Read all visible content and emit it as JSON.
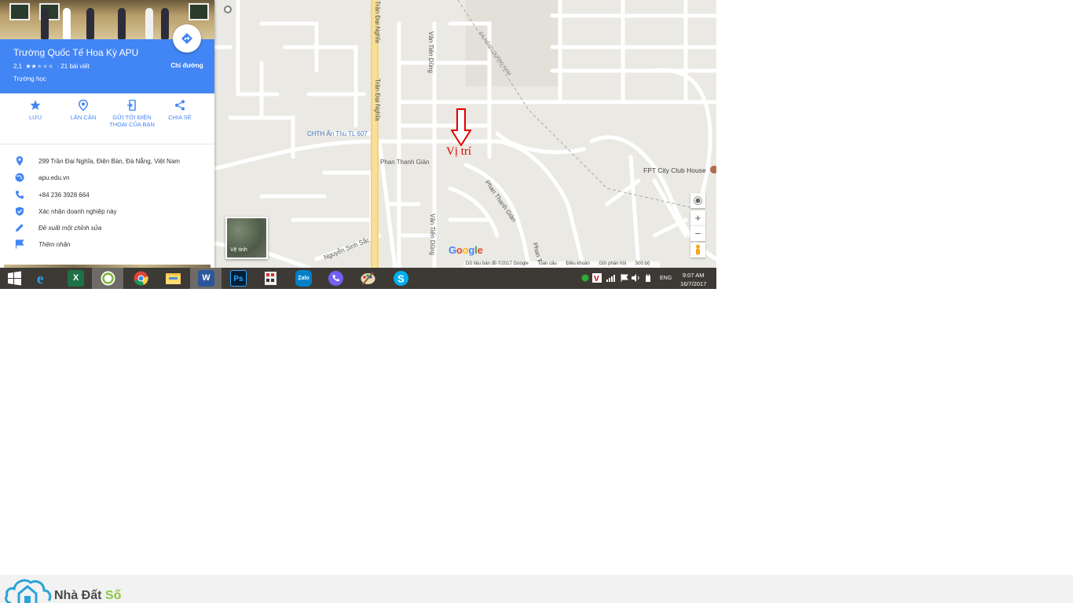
{
  "place": {
    "title": "Trường Quốc Tế Hoa Kỳ APU",
    "rating": "2,1",
    "rating_stars": 2,
    "reviews": "· 21 bài viết",
    "category": "Trường học",
    "directions_label": "Chỉ đường"
  },
  "actions": [
    {
      "label": "LƯU",
      "icon": "star-icon"
    },
    {
      "label": "LÂN CẬN",
      "icon": "nearby-icon"
    },
    {
      "label": "GỬI TỚI ĐIỆN THOẠI CỦA BẠN",
      "icon": "send-to-phone-icon"
    },
    {
      "label": "CHIA SẺ",
      "icon": "share-icon"
    }
  ],
  "info": {
    "address": "299 Trần Đại Nghĩa, Điện Bàn, Đà Nẵng, Việt Nam",
    "website": "apu.edu.vn",
    "phone": "+84 236 3928 664",
    "claim": "Xác nhận doanh nghiệp này",
    "suggest_edit": "Đề xuất một chỉnh sửa",
    "add_label": "Thêm nhãn"
  },
  "map": {
    "labels": {
      "tran_dai_nghia_top": "Trần Đại Nghĩa",
      "tran_dai_nghia": "Trần Đại Nghĩa",
      "van_tien_dung_top": "Văn Tiến Dũng",
      "van_tien_dung_bottom": "Văn Tiến Dũng",
      "da_nang_quang_nam": "ĐÀ NẴNG QUẢNG NAM",
      "chth": "CHTH Ân Thu TL 607",
      "phan_thanh_gian_1": "Phan Thanh Giản",
      "phan_thanh_gian_2": "Phan Thanh Giản",
      "phan_t": "Phan T",
      "nguyen_sinh_sac": "Nguyễn Sinh Sắc",
      "fpt": "FPT City Club House"
    },
    "marker_label": "Vị trí",
    "satellite_label": "Vệ tinh",
    "zoom_in": "+",
    "zoom_out": "−",
    "google": [
      "G",
      "o",
      "o",
      "g",
      "l",
      "e"
    ],
    "google_colors": [
      "#4285f4",
      "#ea4335",
      "#fbbc05",
      "#4285f4",
      "#34a853",
      "#ea4335"
    ],
    "attribution": {
      "data": "Dữ liệu bản đồ ©2017 Google",
      "global": "Toàn cầu",
      "terms": "Điều khoản",
      "feedback": "Gửi phản hồi",
      "scale": "500 bộ"
    }
  },
  "taskbar": {
    "apps": [
      "windows-start-icon",
      "internet-explorer-icon",
      "excel-icon",
      "coccoc-icon",
      "chrome-icon",
      "file-explorer-icon",
      "word-icon",
      "photoshop-icon",
      "calculator-icon",
      "zalo-icon",
      "viber-icon",
      "paint-icon",
      "skype-icon"
    ],
    "xl": "X",
    "wd": "W",
    "ps": "Ps",
    "zalo": "Zalo",
    "lang": "ENG",
    "time": "9:07 AM",
    "date": "16/7/2017"
  },
  "footer": {
    "brand_main": "Nhà Đất",
    "brand_accent": "Số"
  },
  "colors": {
    "accent": "#4285f4",
    "marker": "#e00000",
    "taskbar": "#3d3a35"
  }
}
